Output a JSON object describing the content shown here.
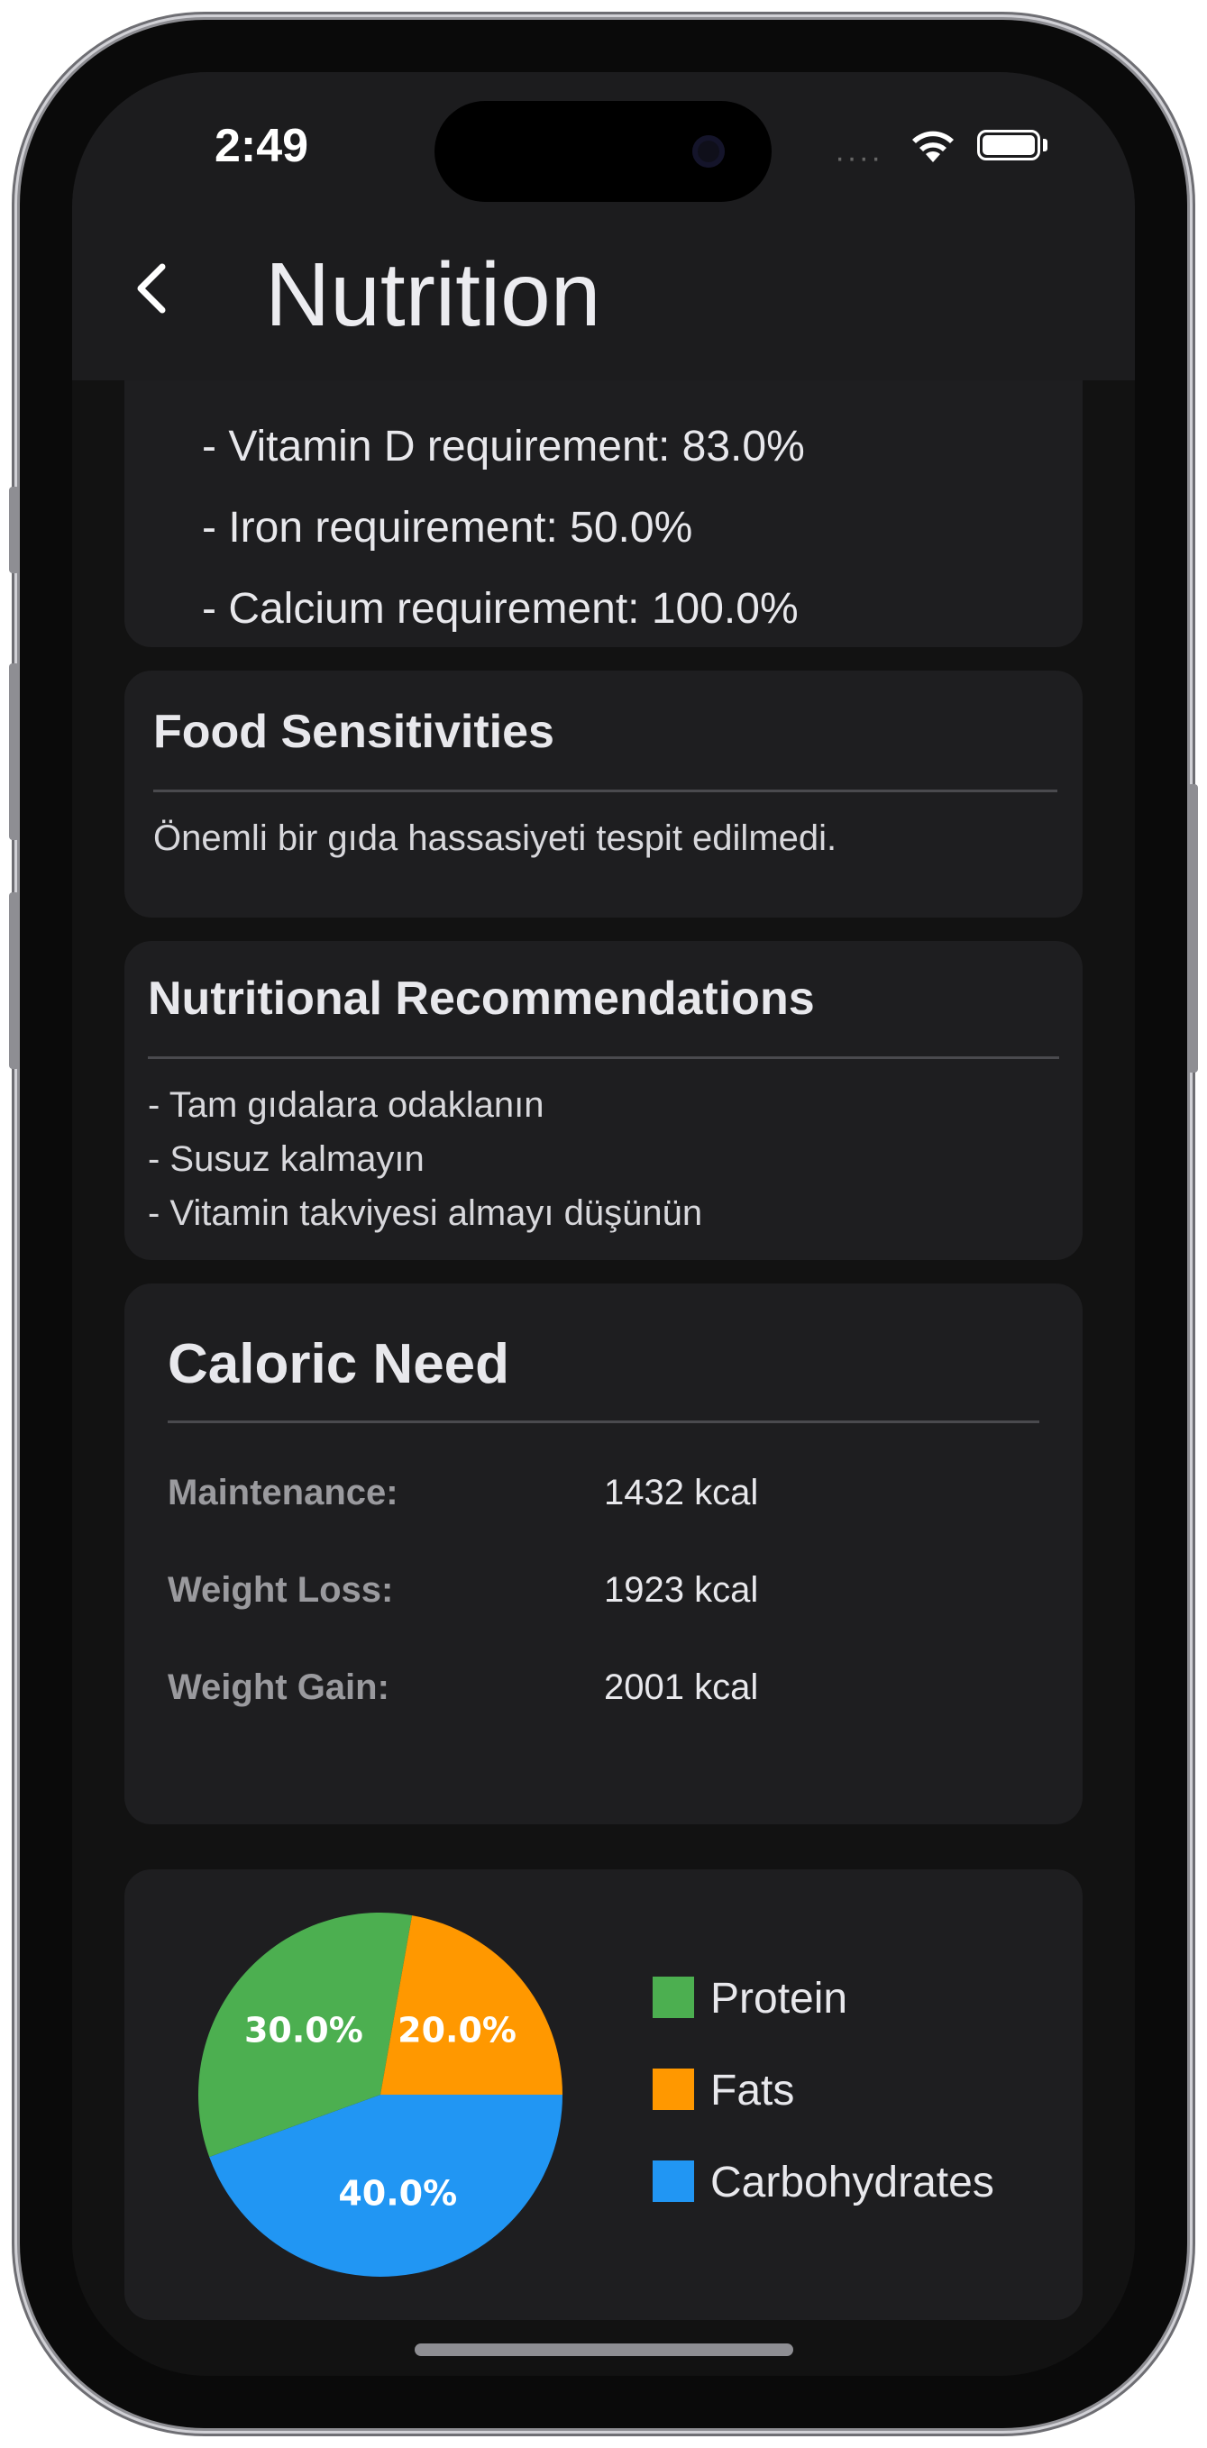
{
  "status_bar": {
    "time": "2:49"
  },
  "nav": {
    "title": "Nutrition",
    "back_icon": "chevron-left-icon"
  },
  "requirements": {
    "items": [
      "- Vitamin D requirement: 83.0%",
      "- Iron requirement: 50.0%",
      "- Calcium  requirement: 100.0%"
    ]
  },
  "food_sensitivities": {
    "title": "Food Sensitivities",
    "text": "Önemli bir gıda hassasiyeti tespit edilmedi."
  },
  "recommendations": {
    "title": "Nutritional Recommendations",
    "items": [
      "- Tam gıdalara odaklanın",
      "- Susuz kalmayın",
      "- Vitamin takviyesi almayı düşünün"
    ]
  },
  "caloric_need": {
    "title": "Caloric Need",
    "rows": [
      {
        "label": "Maintenance:",
        "value": "1432 kcal"
      },
      {
        "label": "Weight Loss:",
        "value": "1923 kcal"
      },
      {
        "label": "Weight Gain:",
        "value": "2001 kcal"
      }
    ]
  },
  "colors": {
    "protein": "#4caf50",
    "fats": "#ff9800",
    "carbohydrates": "#2196f3"
  },
  "chart_data": {
    "type": "pie",
    "slices": [
      {
        "name": "Protein",
        "value": 30.0,
        "label": "30.0%",
        "color": "#4caf50"
      },
      {
        "name": "Fats",
        "value": 20.0,
        "label": "20.0%",
        "color": "#ff9800"
      },
      {
        "name": "Carbohydrates",
        "value": 40.0,
        "label": "40.0%",
        "color": "#2196f3"
      }
    ],
    "legend": [
      "Protein",
      "Fats",
      "Carbohydrates"
    ],
    "legend_placement": "right"
  }
}
